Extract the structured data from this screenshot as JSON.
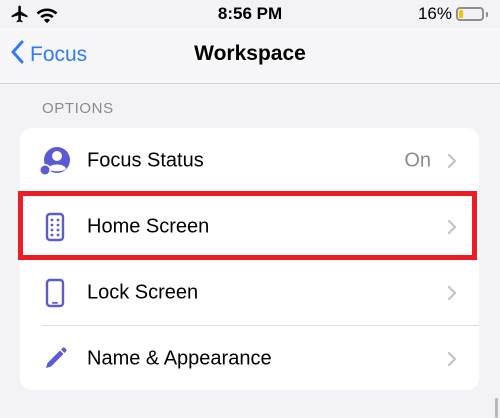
{
  "status_bar": {
    "time": "8:56 PM",
    "battery_percent_label": "16%",
    "battery_level": 0.16,
    "icons": [
      "airplane-icon",
      "wifi-icon"
    ]
  },
  "nav": {
    "back_label": "Focus",
    "title": "Workspace"
  },
  "section": {
    "header": "OPTIONS"
  },
  "rows": [
    {
      "label": "Focus Status",
      "value": "On",
      "icon": "focus-status-icon"
    },
    {
      "label": "Home Screen",
      "value": "",
      "icon": "home-screen-icon"
    },
    {
      "label": "Lock Screen",
      "value": "",
      "icon": "lock-screen-icon"
    },
    {
      "label": "Name & Appearance",
      "value": "",
      "icon": "pencil-icon"
    }
  ],
  "colors": {
    "accent": "#2F7CF6",
    "icon_purple": "#5B5BD6",
    "highlight": "#EE1C25",
    "battery_fill": "#F7C600"
  }
}
